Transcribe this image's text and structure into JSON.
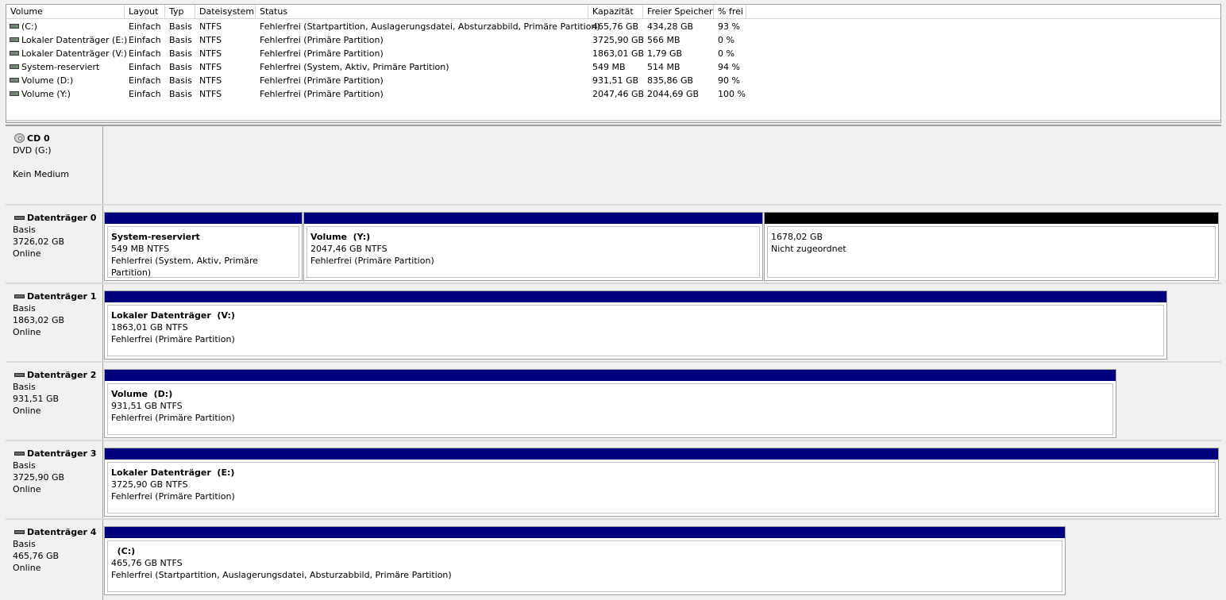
{
  "volume_list": {
    "columns": [
      "Volume",
      "Layout",
      "Typ",
      "Dateisystem",
      "Status",
      "Kapazität",
      "Freier Speicher",
      "% frei"
    ],
    "rows": [
      {
        "volume": " (C:)",
        "layout": "Einfach",
        "type": "Basis",
        "fs": "NTFS",
        "status": "Fehlerfrei (Startpartition, Auslagerungsdatei, Absturzabbild, Primäre Partition)",
        "capacity": "465,76 GB",
        "free": "434,28 GB",
        "pct": "93 %"
      },
      {
        "volume": "Lokaler Datenträger (E:)",
        "layout": "Einfach",
        "type": "Basis",
        "fs": "NTFS",
        "status": "Fehlerfrei (Primäre Partition)",
        "capacity": "3725,90 GB",
        "free": "566 MB",
        "pct": "0 %"
      },
      {
        "volume": "Lokaler Datenträger (V:)",
        "layout": "Einfach",
        "type": "Basis",
        "fs": "NTFS",
        "status": "Fehlerfrei (Primäre Partition)",
        "capacity": "1863,01 GB",
        "free": "1,79 GB",
        "pct": "0 %"
      },
      {
        "volume": "System-reserviert",
        "layout": "Einfach",
        "type": "Basis",
        "fs": "NTFS",
        "status": "Fehlerfrei (System, Aktiv, Primäre Partition)",
        "capacity": "549 MB",
        "free": "514 MB",
        "pct": "94 %"
      },
      {
        "volume": "Volume (D:)",
        "layout": "Einfach",
        "type": "Basis",
        "fs": "NTFS",
        "status": "Fehlerfrei (Primäre Partition)",
        "capacity": "931,51 GB",
        "free": "835,86 GB",
        "pct": "90 %"
      },
      {
        "volume": "Volume (Y:)",
        "layout": "Einfach",
        "type": "Basis",
        "fs": "NTFS",
        "status": "Fehlerfrei (Primäre Partition)",
        "capacity": "2047,46 GB",
        "free": "2044,69 GB",
        "pct": "100 %"
      }
    ]
  },
  "disks": [
    {
      "title": "CD 0",
      "line1": "DVD (G:)",
      "line2": "",
      "line3": "Kein Medium",
      "icon": "cd-icon"
    },
    {
      "title": "Datenträger 0",
      "line1": "Basis",
      "line2": "3726,02 GB",
      "line3": "Online",
      "icon": "disk-icon",
      "partitions": [
        {
          "name": "System-reserviert",
          "size": "549 MB NTFS",
          "status": "Fehlerfrei (System, Aktiv, Primäre Partition)"
        },
        {
          "name": "Volume  (Y:)",
          "size": "2047,46 GB NTFS",
          "status": "Fehlerfrei (Primäre Partition)"
        },
        {
          "name": "",
          "size": "1678,02 GB",
          "status": "Nicht zugeordnet"
        }
      ]
    },
    {
      "title": "Datenträger 1",
      "line1": "Basis",
      "line2": "1863,02 GB",
      "line3": "Online",
      "icon": "disk-icon",
      "partitions": [
        {
          "name": "Lokaler Datenträger  (V:)",
          "size": "1863,01 GB NTFS",
          "status": "Fehlerfrei (Primäre Partition)"
        }
      ]
    },
    {
      "title": "Datenträger 2",
      "line1": "Basis",
      "line2": "931,51 GB",
      "line3": "Online",
      "icon": "disk-icon",
      "partitions": [
        {
          "name": "Volume  (D:)",
          "size": "931,51 GB NTFS",
          "status": "Fehlerfrei (Primäre Partition)"
        }
      ]
    },
    {
      "title": "Datenträger 3",
      "line1": "Basis",
      "line2": "3725,90 GB",
      "line3": "Online",
      "icon": "disk-icon",
      "partitions": [
        {
          "name": "Lokaler Datenträger  (E:)",
          "size": "3725,90 GB NTFS",
          "status": "Fehlerfrei (Primäre Partition)"
        }
      ]
    },
    {
      "title": "Datenträger 4",
      "line1": "Basis",
      "line2": "465,76 GB",
      "line3": "Online",
      "icon": "disk-icon",
      "partitions": [
        {
          "name": "  (C:)",
          "size": "465,76 GB NTFS",
          "status": "Fehlerfrei (Startpartition, Auslagerungsdatei, Absturzabbild, Primäre Partition)"
        }
      ]
    }
  ],
  "colors": {
    "primary_partition": "#00007f",
    "unallocated": "#000000"
  }
}
